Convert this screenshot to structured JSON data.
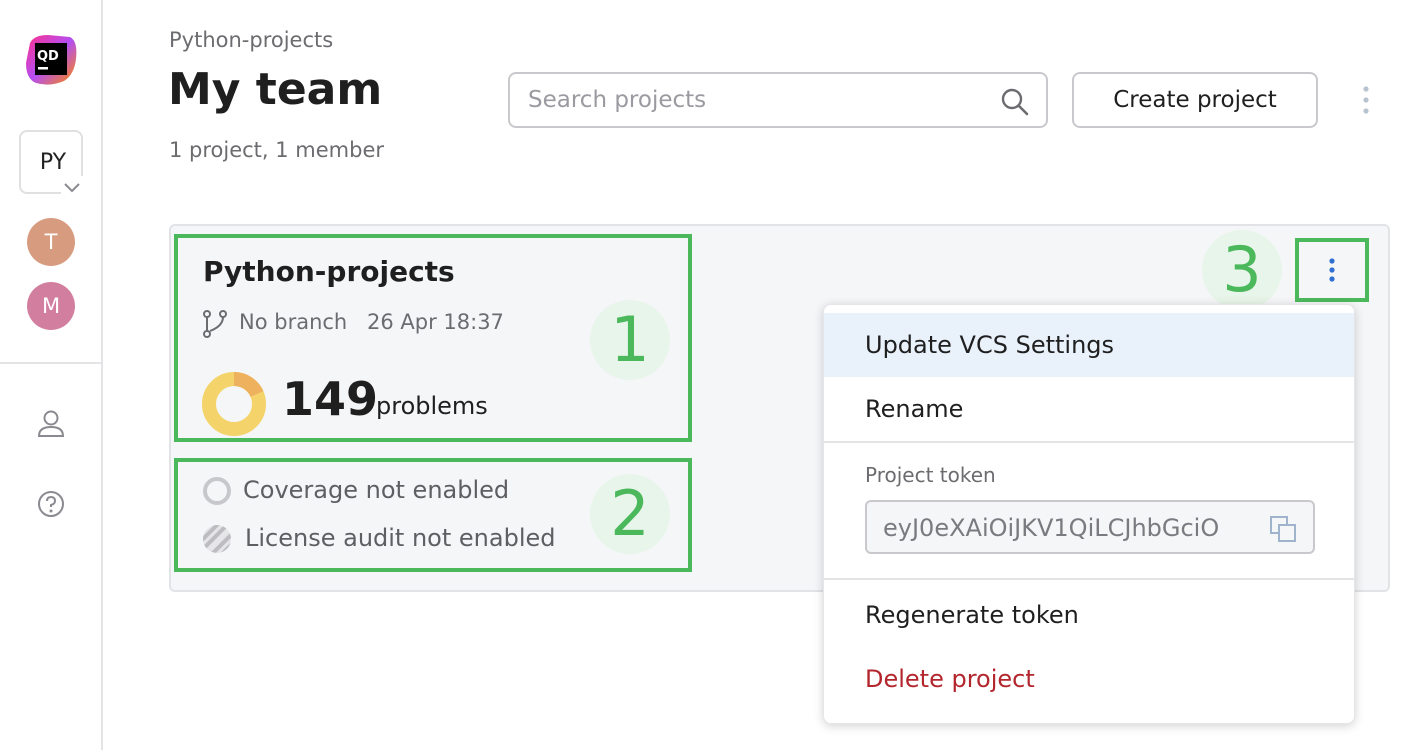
{
  "app": {
    "logo_text": "QD",
    "brand_colors": {
      "accent_green": "#4cb85c",
      "delete_red": "#b3262d",
      "highlight_blue": "#e9f1fb"
    }
  },
  "sidebar": {
    "team_switch_label": "PY",
    "avatars": [
      {
        "initial": "T",
        "color": "#d79c80"
      },
      {
        "initial": "M",
        "color": "#d27f9f"
      }
    ],
    "icons": [
      "user-icon",
      "help-icon"
    ]
  },
  "header": {
    "breadcrumb": "Python-projects",
    "title": "My team",
    "subtitle": "1 project, 1 member",
    "search_placeholder": "Search projects",
    "create_button": "Create project"
  },
  "project": {
    "name": "Python-projects",
    "branch": "No branch",
    "date": "26 Apr 18:37",
    "problems_count": "149",
    "problems_label": "problems",
    "coverage": "Coverage not enabled",
    "license": "License audit not enabled"
  },
  "callouts": [
    "1",
    "2",
    "3"
  ],
  "menu": {
    "update_vcs": "Update VCS Settings",
    "rename": "Rename",
    "token_label": "Project token",
    "token_value": "eyJ0eXAiOiJKV1QiLCJhbGciO",
    "regenerate": "Regenerate token",
    "delete": "Delete project"
  }
}
